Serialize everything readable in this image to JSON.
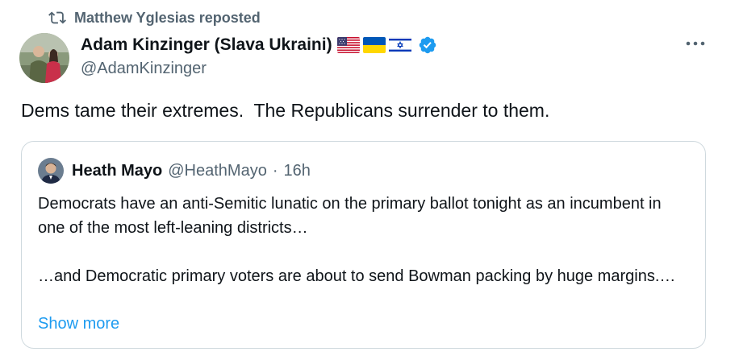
{
  "repost": {
    "text": "Matthew Yglesias reposted",
    "icon": "repost-icon"
  },
  "author": {
    "name": "Adam Kinzinger (Slava Ukraini)",
    "handle": "@AdamKinzinger",
    "flags": [
      "us-flag-icon",
      "ukraine-flag-icon",
      "israel-flag-icon"
    ],
    "verified_icon": "verified-badge-icon",
    "more_icon": "more-icon"
  },
  "tweet": {
    "text": "Dems tame their extremes.  The Republicans surrender to them."
  },
  "quote": {
    "name": "Heath Mayo",
    "handle": "@HeathMayo",
    "separator": "·",
    "time": "16h",
    "paragraph1": "Democrats have an anti-Semitic lunatic on the primary ballot tonight as an incumbent in one of the most left-leaning districts…",
    "paragraph2": "…and Democratic primary voters are about to send Bowman packing by huge margins.…",
    "show_more": "Show more"
  },
  "colors": {
    "text": "#0f1419",
    "secondary": "#536471",
    "link": "#1d9bf0",
    "border": "#cfd9de",
    "verified": "#1d9bf0"
  }
}
